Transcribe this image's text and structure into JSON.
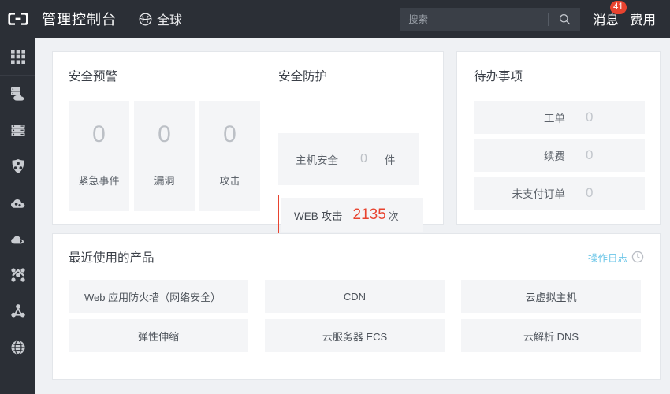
{
  "header": {
    "logo": "cloud-logo",
    "console_title": "管理控制台",
    "region_icon": "globe-icon",
    "region_label": "全球",
    "search": {
      "placeholder": "搜索",
      "value": "",
      "icon": "search-icon"
    },
    "right_items": [
      {
        "label": "消息",
        "badge": "41"
      },
      {
        "label": "费用",
        "badge": ""
      }
    ]
  },
  "sidebar": {
    "items": [
      {
        "icon": "grid-apps-icon",
        "name": "all-products"
      },
      {
        "icon": "server-cloud-icon",
        "name": "elastic-compute"
      },
      {
        "icon": "database-stack-icon",
        "name": "database"
      },
      {
        "icon": "shield-network-icon",
        "name": "security"
      },
      {
        "icon": "cloud-nodes-icon",
        "name": "cloud-service"
      },
      {
        "icon": "cloud-storage-icon",
        "name": "storage"
      },
      {
        "icon": "network-cross-icon",
        "name": "network"
      },
      {
        "icon": "nodes-cluster-icon",
        "name": "cluster"
      },
      {
        "icon": "globe-icon",
        "name": "domain"
      }
    ]
  },
  "security_alert": {
    "title": "安全预警",
    "stats": [
      {
        "value": "0",
        "label": "紧急事件"
      },
      {
        "value": "0",
        "label": "漏洞"
      },
      {
        "value": "0",
        "label": "攻击"
      }
    ]
  },
  "security_protection": {
    "title": "安全防护",
    "host_security": {
      "label": "主机安全",
      "value": "0",
      "unit": "件"
    },
    "web_attack": {
      "label": "WEB 攻击",
      "value": "2135",
      "unit": "次",
      "highlight_color": "#e8432f"
    }
  },
  "todo": {
    "title": "待办事项",
    "rows": [
      {
        "label": "工单",
        "value": "0"
      },
      {
        "label": "续费",
        "value": "0"
      },
      {
        "label": "未支付订单",
        "value": "0"
      }
    ]
  },
  "recent_products": {
    "title": "最近使用的产品",
    "op_log_label": "操作日志",
    "op_log_icon": "clock-icon",
    "tiles": [
      "Web 应用防火墙（网络安全）",
      "CDN",
      "云虚拟主机",
      "弹性伸缩",
      "云服务器 ECS",
      "云解析 DNS"
    ]
  },
  "colors": {
    "header_bg": "#2b2f36",
    "page_bg": "#eff1f4",
    "accent_red": "#e8432f",
    "link_blue": "#6cc6e8",
    "tile_bg": "#f4f5f7"
  }
}
